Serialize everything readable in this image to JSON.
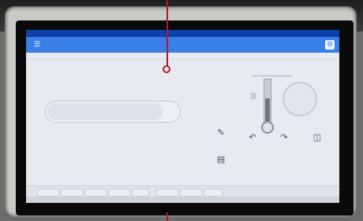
{
  "window": {
    "titlebar_left": "",
    "titlebar_right": "",
    "app_title": "",
    "menu_icon": "menu-icon",
    "settings_icon": "gear-icon",
    "accent": "#3a7fe8",
    "titlebar_color": "#0f3fa8"
  },
  "left_panel": {
    "section_label": "",
    "counter_text": "",
    "counter_sub": "",
    "bar_caption": "",
    "bar_scale": "",
    "bar_fill_fraction": 0.88
  },
  "right_panel": {
    "section_label": "",
    "gauge_fill_fraction": 0.55
  },
  "tools": [
    {
      "icon": "pen-icon",
      "label": ""
    },
    {
      "icon": "document-icon",
      "label": ""
    },
    {
      "icon": "undo-icon",
      "label": ""
    },
    {
      "icon": "redo-icon",
      "label": ""
    },
    {
      "icon": "folder-icon",
      "label": ""
    }
  ],
  "bottom": {
    "label": "",
    "tabs": [
      "",
      "",
      "",
      "",
      "",
      "",
      "",
      ""
    ]
  }
}
